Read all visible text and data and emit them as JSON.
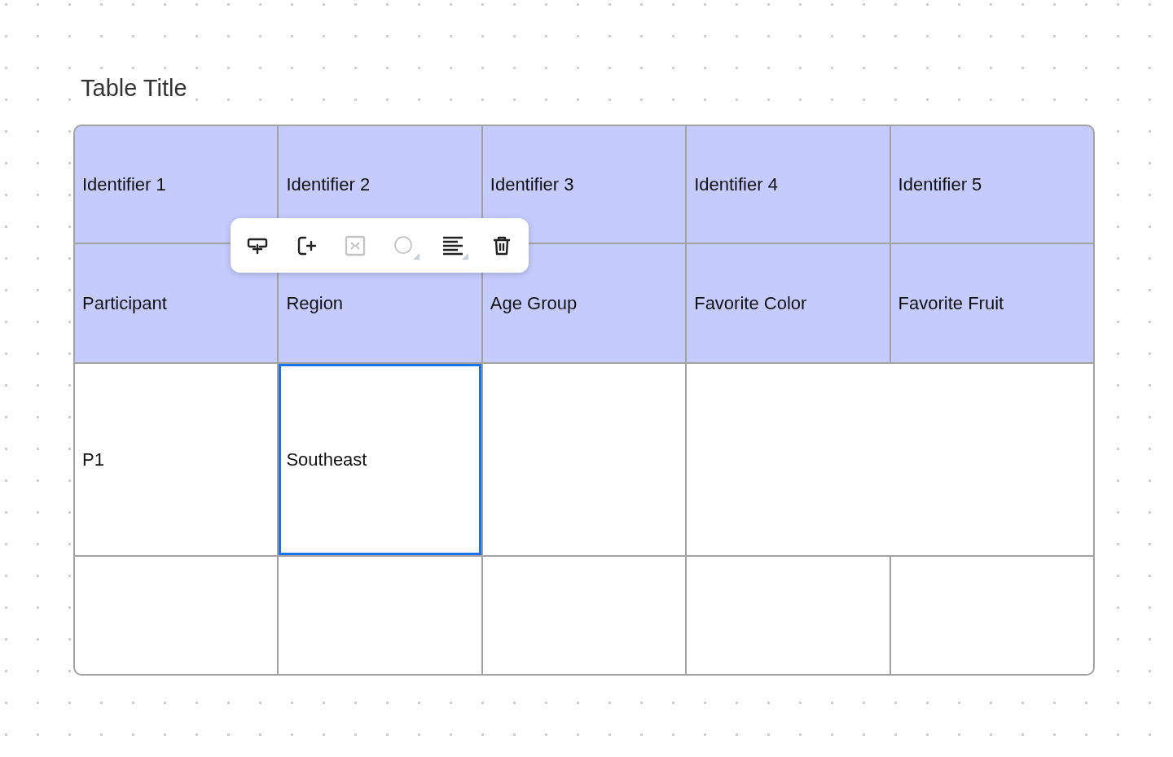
{
  "title": "Table Title",
  "table": {
    "rows": [
      {
        "kind": "header",
        "cells": [
          {
            "text": "Identifier 1",
            "selected": false
          },
          {
            "text": "Identifier 2",
            "selected": false
          },
          {
            "text": "Identifier 3",
            "selected": false
          },
          {
            "text": "Identifier 4",
            "selected": false
          },
          {
            "text": "Identifier 5",
            "selected": false
          }
        ]
      },
      {
        "kind": "header",
        "cells": [
          {
            "text": "Participant",
            "selected": false
          },
          {
            "text": "Region",
            "selected": false
          },
          {
            "text": "Age Group",
            "selected": false
          },
          {
            "text": "Favorite Color",
            "selected": false
          },
          {
            "text": "Favorite Fruit",
            "selected": false
          }
        ]
      },
      {
        "kind": "body",
        "cells": [
          {
            "text": "P1",
            "selected": false
          },
          {
            "text": "Southeast",
            "selected": true
          },
          {
            "selected": false
          },
          {
            "selected": false,
            "merged": true
          }
        ]
      },
      {
        "kind": "body",
        "cells": [
          {
            "selected": false
          },
          {
            "selected": false
          },
          {
            "selected": false
          },
          {
            "selected": false
          },
          {
            "selected": false
          }
        ]
      }
    ]
  },
  "toolbar": [
    {
      "kind": "insert-row",
      "disabled": false,
      "has_menu": false
    },
    {
      "kind": "insert-column",
      "disabled": false,
      "has_menu": false
    },
    {
      "kind": "merge",
      "disabled": true,
      "has_menu": false
    },
    {
      "kind": "color",
      "disabled": false,
      "has_menu": true
    },
    {
      "kind": "align",
      "disabled": false,
      "has_menu": true
    },
    {
      "kind": "delete",
      "disabled": false,
      "has_menu": false
    }
  ]
}
